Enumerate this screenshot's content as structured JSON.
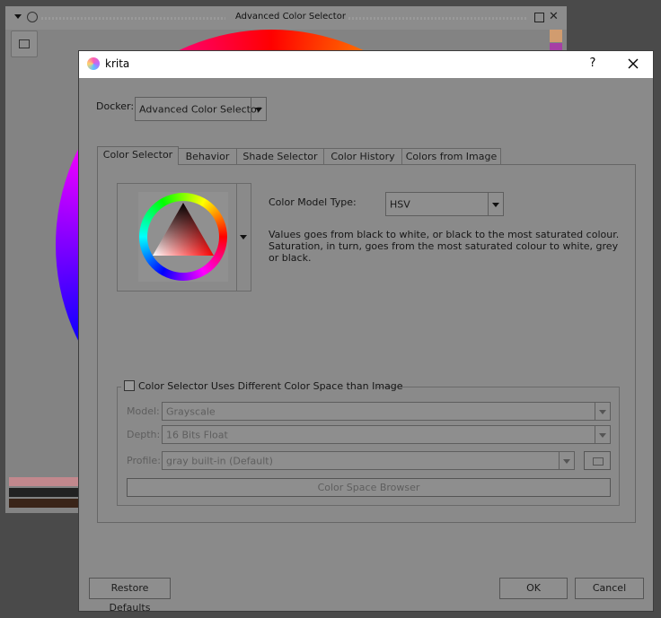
{
  "background": {
    "docker_title": "Advanced Color Selector"
  },
  "dialog": {
    "title": "krita",
    "help": "?",
    "docker_label": "Docker:",
    "docker_value": "Advanced Color Selector",
    "tabs": [
      {
        "label": "Color Selector",
        "active": true
      },
      {
        "label": "Behavior"
      },
      {
        "label": "Shade Selector"
      },
      {
        "label": "Color History"
      },
      {
        "label": "Colors from Image"
      }
    ],
    "color_model_label": "Color Model Type:",
    "color_model_value": "HSV",
    "description": "Values goes from black to white, or black to the most saturated colour. Saturation, in turn, goes from the most saturated colour to white, grey or black.",
    "color_space_checkbox": {
      "label": "Color Selector Uses Different Color Space than Image",
      "checked": false
    },
    "model_label": "Model:",
    "model_value": "Grayscale",
    "depth_label": "Depth:",
    "depth_value": "16 Bits Float",
    "profile_label": "Profile:",
    "profile_value": "gray built-in (Default)",
    "color_space_browser": "Color Space Browser",
    "restore_defaults": "Restore Defaults",
    "ok": "OK",
    "cancel": "Cancel"
  }
}
